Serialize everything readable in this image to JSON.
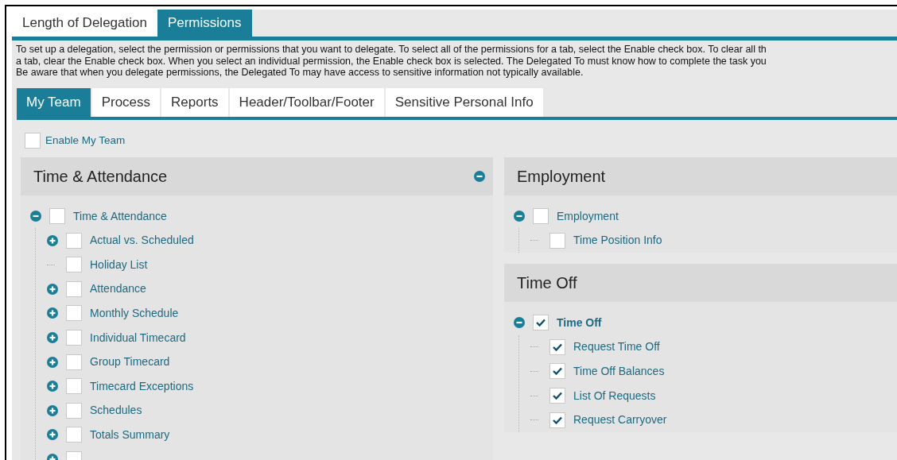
{
  "top_tabs": [
    {
      "label": "Length of Delegation",
      "selected": false
    },
    {
      "label": "Permissions",
      "selected": true
    }
  ],
  "description": [
    "To set up a delegation, select the permission or permissions that you want to delegate. To select all of the permissions for a tab, select the Enable check box. To clear all th",
    "a tab, clear the Enable check box. When you select an individual permission, the Enable check box is selected. The Delegated To must know how to complete the task you",
    "Be aware that when you delegate permissions, the Delegated To may have access to sensitive information not typically available."
  ],
  "sub_tabs": [
    {
      "label": "My Team",
      "selected": true
    },
    {
      "label": "Process",
      "selected": false
    },
    {
      "label": "Reports",
      "selected": false
    },
    {
      "label": "Header/Toolbar/Footer",
      "selected": false
    },
    {
      "label": "Sensitive Personal Info",
      "selected": false
    }
  ],
  "enable": {
    "label": "Enable My Team",
    "checked": false
  },
  "columns": [
    [
      {
        "title": "Time & Attendance",
        "expanded": true,
        "items": [
          {
            "label": "Time & Attendance",
            "checked": false,
            "kind": "group",
            "expanded": true,
            "children": [
              {
                "label": "Actual vs. Scheduled",
                "checked": false,
                "kind": "group",
                "expanded": false
              },
              {
                "label": "Holiday List",
                "checked": false,
                "kind": "leaf"
              },
              {
                "label": "Attendance",
                "checked": false,
                "kind": "group",
                "expanded": false
              },
              {
                "label": "Monthly Schedule",
                "checked": false,
                "kind": "group",
                "expanded": false
              },
              {
                "label": "Individual Timecard",
                "checked": false,
                "kind": "group",
                "expanded": false
              },
              {
                "label": "Group Timecard",
                "checked": false,
                "kind": "group",
                "expanded": false
              },
              {
                "label": "Timecard Exceptions",
                "checked": false,
                "kind": "group",
                "expanded": false
              },
              {
                "label": "Schedules",
                "checked": false,
                "kind": "group",
                "expanded": false
              },
              {
                "label": "Totals Summary",
                "checked": false,
                "kind": "group",
                "expanded": false
              },
              {
                "checked": false,
                "kind": "group",
                "expanded": false
              }
            ]
          }
        ]
      }
    ],
    [
      {
        "title": "Employment",
        "expanded": true,
        "items": [
          {
            "label": "Employment",
            "checked": false,
            "kind": "group",
            "expanded": true,
            "children": [
              {
                "label": "Time Position Info",
                "checked": false,
                "kind": "leaf"
              }
            ]
          }
        ]
      },
      {
        "title": "Time Off",
        "expanded": true,
        "items": [
          {
            "label": "Time Off",
            "checked": true,
            "kind": "group",
            "expanded": true,
            "children": [
              {
                "label": "Request Time Off",
                "checked": true,
                "kind": "leaf"
              },
              {
                "label": "Time Off Balances",
                "checked": true,
                "kind": "leaf"
              },
              {
                "label": "List Of Requests",
                "checked": true,
                "kind": "leaf"
              },
              {
                "label": "Request Carryover",
                "checked": true,
                "kind": "leaf"
              }
            ]
          }
        ]
      }
    ]
  ]
}
